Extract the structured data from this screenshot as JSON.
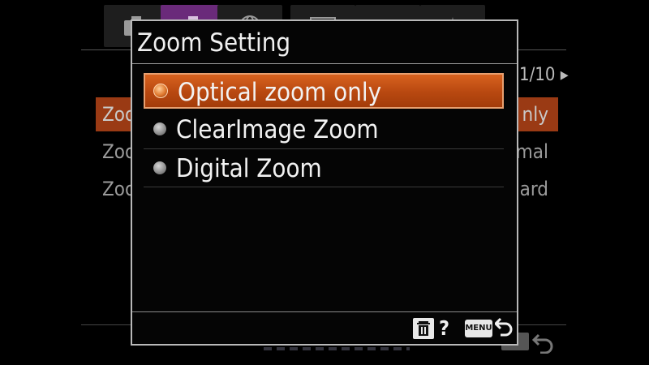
{
  "background_menu": {
    "page_indicator": "1/10 ▸",
    "rows": [
      {
        "label": "Zoo",
        "value": "nly"
      },
      {
        "label": "Zoo",
        "value": "mal"
      },
      {
        "label": "Zoo",
        "value": "ard"
      }
    ],
    "tabs": [
      "camera-icon",
      "camera-settings-icon",
      "globe-icon",
      "playback-icon",
      "toolbox-icon",
      "setup-icon"
    ]
  },
  "dialog": {
    "title": "Zoom Setting",
    "options": [
      {
        "label": "Optical zoom only",
        "selected": true
      },
      {
        "label": "ClearImage Zoom",
        "selected": false
      },
      {
        "label": "Digital Zoom",
        "selected": false
      }
    ],
    "footer": {
      "help_label": "?",
      "menu_label": "MENU",
      "icons": [
        "trash-icon",
        "return-icon"
      ]
    }
  },
  "colors": {
    "accent": "#c4511a",
    "active_tab": "#6a2a7a",
    "background": "#000000",
    "border": "#b9b9b9"
  }
}
